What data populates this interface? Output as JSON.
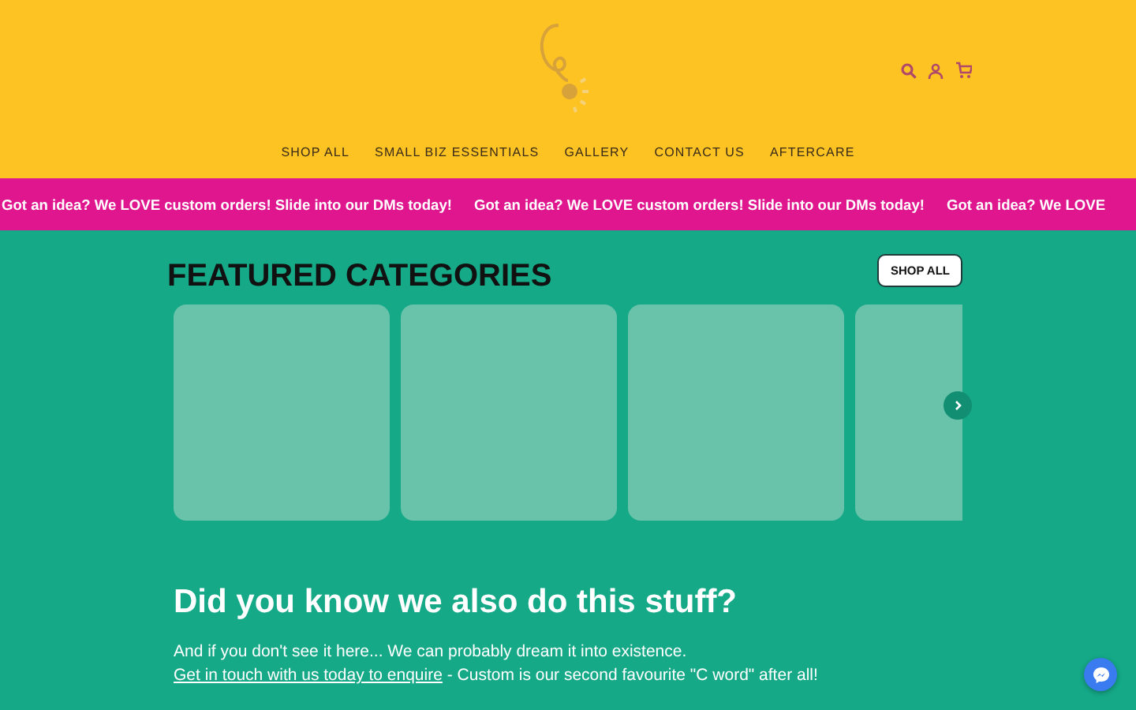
{
  "header": {
    "nav": [
      "SHOP ALL",
      "SMALL BIZ ESSENTIALS",
      "GALLERY",
      "CONTACT US",
      "AFTERCARE"
    ]
  },
  "announcement": [
    "Got an idea? We LOVE custom orders! Slide into our DMs today!",
    "Got an idea? We LOVE custom orders! Slide into our DMs today!",
    "Got an idea? We LOVE"
  ],
  "featured": {
    "title": "FEATURED CATEGORIES",
    "button": "SHOP ALL"
  },
  "info": {
    "heading": "Did you know we also do this stuff?",
    "line_1": "And if you don't see it here... We can probably dream it into existence.",
    "link": "Get in touch with us today to enquire",
    "line_2": " - Custom is our second favourite \"C word\" after all!"
  }
}
